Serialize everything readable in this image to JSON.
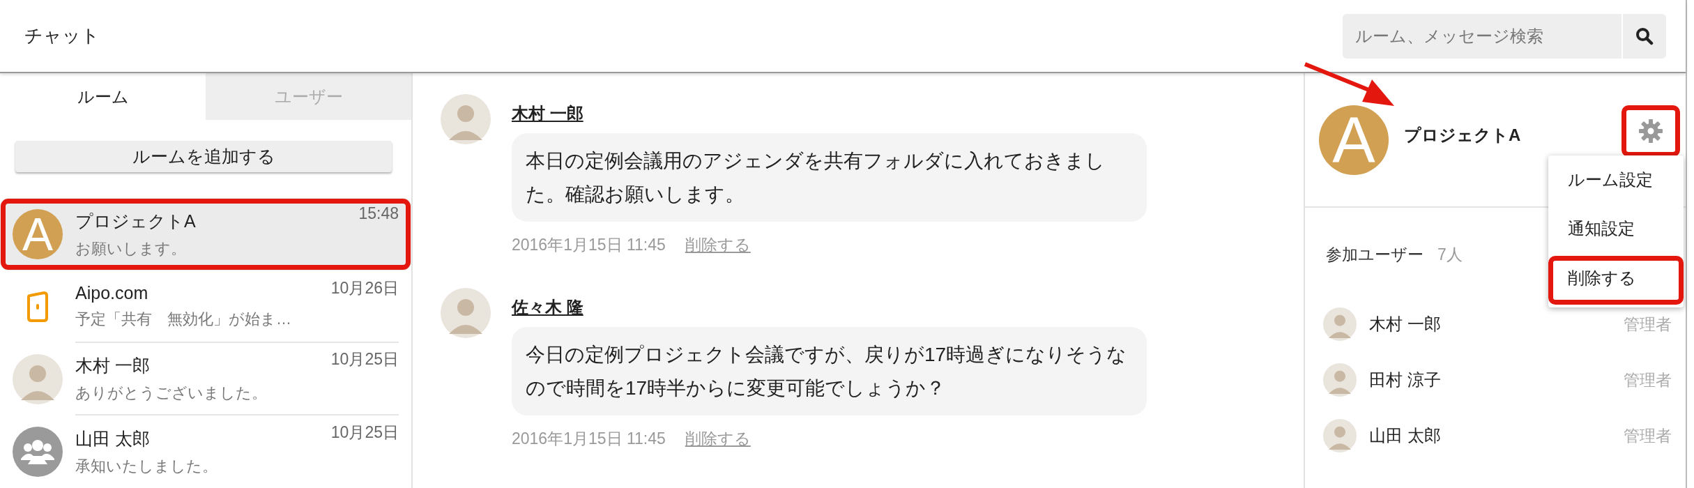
{
  "header": {
    "title": "チャット",
    "search": {
      "placeholder": "ルーム、メッセージ検索"
    }
  },
  "sidebar": {
    "tabs": [
      {
        "label": "ルーム",
        "selected": true
      },
      {
        "label": "ユーザー",
        "selected": false
      }
    ],
    "add_button": "ルームを追加する",
    "rooms": [
      {
        "kind": "letter",
        "avatar_letter": "A",
        "name": "プロジェクトA",
        "time": "15:48",
        "preview": "お願いします。",
        "selected": true,
        "highlighted": true
      },
      {
        "kind": "app",
        "name": "Aipo.com",
        "time": "10月26日",
        "preview": "予定「共有　無効化」が始ま…",
        "selected": false,
        "highlighted": false
      },
      {
        "kind": "photo",
        "name": "木村 一郎",
        "time": "10月25日",
        "preview": "ありがとうございました。",
        "selected": false,
        "highlighted": false
      },
      {
        "kind": "group",
        "name": "山田 太郎",
        "time": "10月25日",
        "preview": "承知いたしました。",
        "selected": false,
        "highlighted": false
      }
    ]
  },
  "messages": [
    {
      "author": "木村 一郎",
      "text": "本日の定例会議用のアジェンダを共有フォルダに入れておきました。確認お願いします。",
      "date": "2016年1月15日 11:45",
      "delete_link": "削除する"
    },
    {
      "author": "佐々木 隆",
      "text": "今日の定例プロジェクト会議ですが、戻りが17時過ぎになりそうなので時間を17時半からに変更可能でしょうか？",
      "date": "2016年1月15日 11:45",
      "delete_link": "削除する"
    }
  ],
  "room_info": {
    "avatar_letter": "A",
    "name": "プロジェクトA",
    "settings_highlighted": true,
    "menu": {
      "open": true,
      "items": [
        {
          "label": "ルーム設定",
          "highlighted": false
        },
        {
          "label": "通知設定",
          "highlighted": false
        },
        {
          "label": "削除する",
          "highlighted": true
        }
      ]
    },
    "members_label": "参加ユーザー",
    "members_count": "7人",
    "members": [
      {
        "name": "木村 一郎",
        "role": "管理者"
      },
      {
        "name": "田村 涼子",
        "role": "管理者"
      },
      {
        "name": "山田 太郎",
        "role": "管理者"
      }
    ]
  }
}
